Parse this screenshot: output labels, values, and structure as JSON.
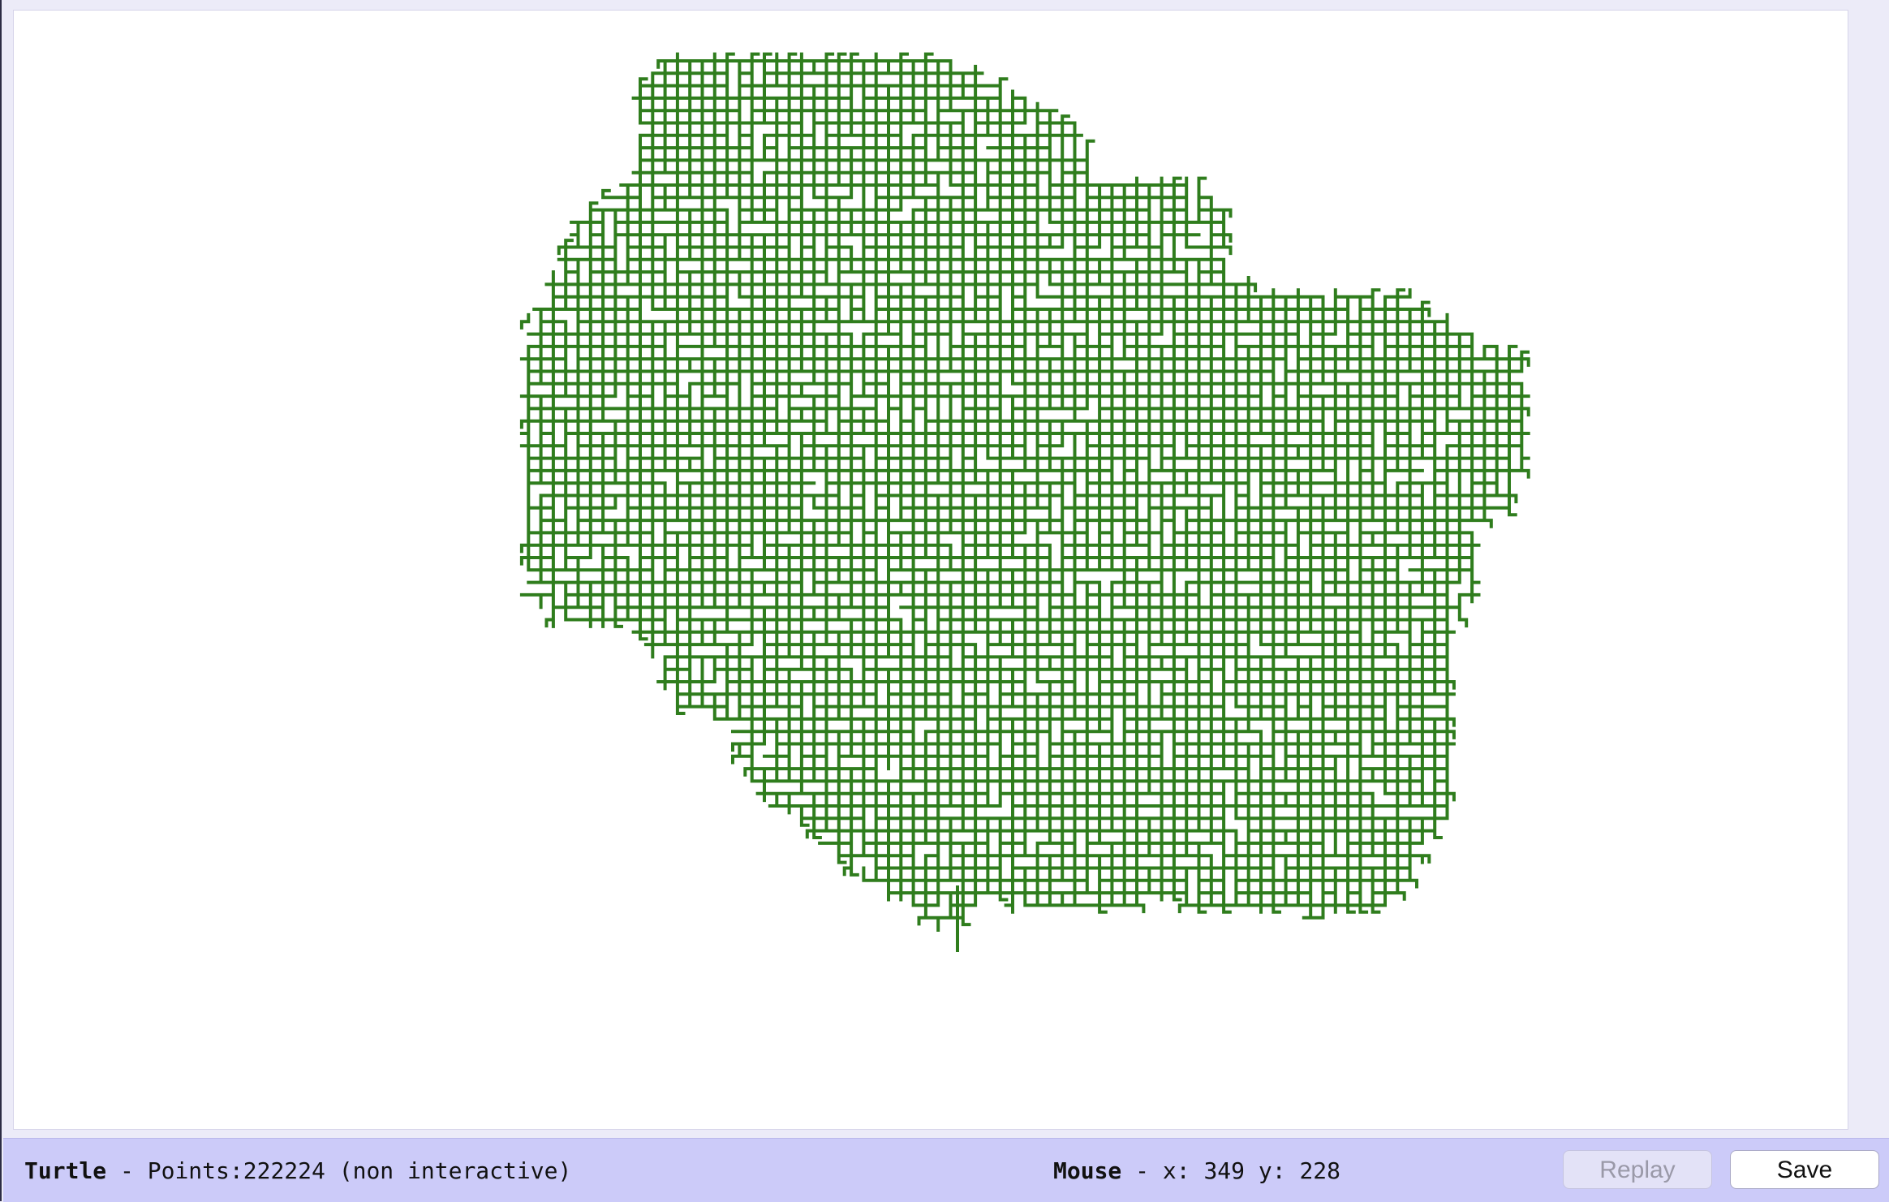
{
  "canvas": {
    "stroke_color": "#2f7d1d",
    "background": "#ffffff"
  },
  "status": {
    "turtle_label": "Turtle",
    "turtle_text": " - Points:222224 (non interactive)",
    "mouse_label": "Mouse",
    "mouse_text": " - x: 349 y: 228"
  },
  "buttons": {
    "replay_label": "Replay",
    "save_label": "Save"
  }
}
